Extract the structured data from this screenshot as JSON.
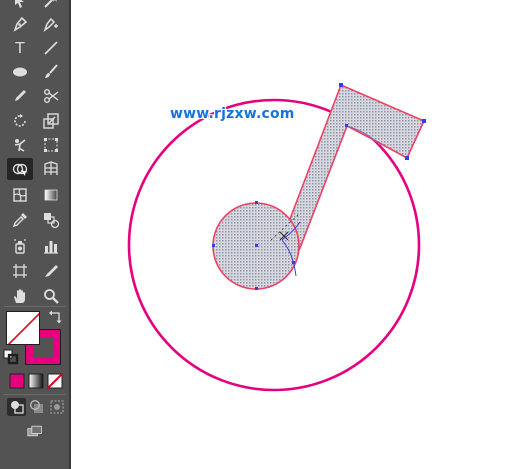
{
  "watermark": {
    "text": "www.rjzxw.com"
  },
  "toolbar": {
    "tools": [
      {
        "name": "pen-icon"
      },
      {
        "name": "line-segment-icon"
      },
      {
        "name": "type-icon",
        "glyph": "T"
      },
      {
        "name": "ellipse-icon"
      },
      {
        "name": "paintbrush-icon"
      },
      {
        "name": "pencil-icon"
      },
      {
        "name": "scissors-icon"
      },
      {
        "name": "rotate-icon"
      },
      {
        "name": "scale-icon"
      },
      {
        "name": "puppet-warp-icon"
      },
      {
        "name": "free-transform-icon"
      },
      {
        "name": "shape-builder-icon"
      },
      {
        "name": "graph-icon"
      },
      {
        "name": "mesh-icon"
      },
      {
        "name": "gradient-icon"
      },
      {
        "name": "eyedropper-icon"
      },
      {
        "name": "blend-icon"
      },
      {
        "name": "symbol-sprayer-icon"
      },
      {
        "name": "column-graph-icon"
      },
      {
        "name": "artboard-icon"
      },
      {
        "name": "slice-icon"
      },
      {
        "name": "hand-icon"
      },
      {
        "name": "zoom-icon"
      }
    ],
    "fill": {
      "state": "none"
    },
    "stroke": {
      "color": "#e4007f"
    },
    "color_modes": [
      "color",
      "gradient",
      "none"
    ],
    "draw_modes": [
      "draw-normal",
      "draw-behind",
      "draw-inside"
    ],
    "screen_mode": "change-screen-mode"
  },
  "canvas": {
    "accent": "#e4007f",
    "path_stroke": "#ee4263",
    "fill_pattern": "#b5b8c4",
    "anchor_color": "#3d3dd6",
    "selected_tool": "shape-builder"
  }
}
